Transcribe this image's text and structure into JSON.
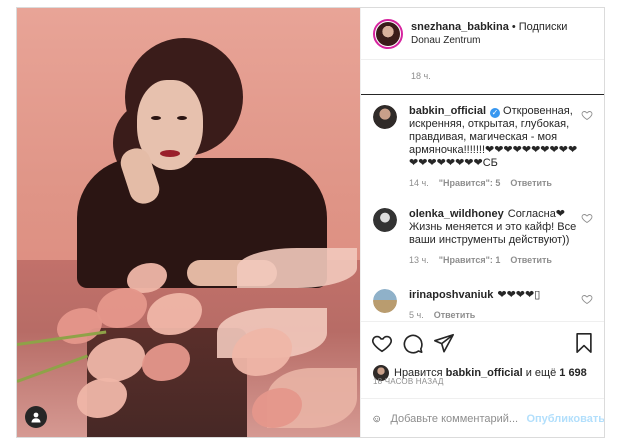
{
  "post": {
    "image_alt": "",
    "username": "snezhana_babkina",
    "separator": "•",
    "follow_label": "Подписки",
    "location": "Donau Zentrum"
  },
  "comments": {
    "previous_time": "18 ч.",
    "items": [
      {
        "username": "babkin_official",
        "verified": true,
        "text": "Откровенная, искренняя, открытая, глубокая, правдивая, магическая - моя армяночка!!!!!!!❤❤❤❤❤❤❤❤❤❤❤❤❤❤❤❤❤❤СБ",
        "time": "14 ч.",
        "likes": "\"Нравится\": 5",
        "reply": "Ответить"
      },
      {
        "username": "olenka_wildhoney",
        "verified": false,
        "text": "Согласна❤ Жизнь меняется и это кайф! Все ваши инструменты действуют))",
        "time": "13 ч.",
        "likes": "\"Нравится\": 1",
        "reply": "Ответить"
      },
      {
        "username": "irinaposhvaniuk",
        "verified": false,
        "text": "❤❤❤❤▯",
        "time": "5 ч.",
        "likes": "",
        "reply": "Ответить"
      }
    ]
  },
  "actions": {
    "likes_prefix": "Нравится",
    "likes_user": "babkin_official",
    "likes_suffix": "и ещё",
    "likes_count": "1 698",
    "date": "18 ЧАСОВ НАЗАД"
  },
  "add_comment": {
    "placeholder": "Добавьте комментарий...",
    "post_label": "Опубликовать"
  },
  "icons": {
    "heart": "heart-icon",
    "comment": "comment-icon",
    "share": "share-icon",
    "save": "bookmark-icon",
    "emoji": "emoji-icon",
    "user_tag": "user-icon",
    "verified": "verified-badge-icon"
  },
  "colors": {
    "link_blue": "#3897f0",
    "post_disabled": "#b2dffc",
    "muted_text": "#8e8e8e",
    "story_ring": "#d6249f"
  }
}
